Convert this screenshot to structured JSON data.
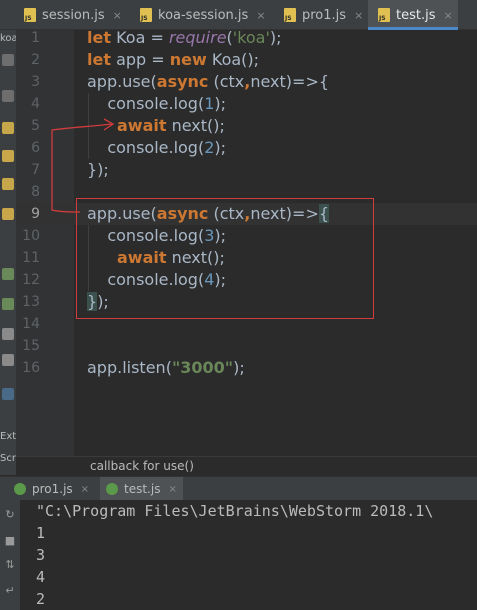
{
  "tabs": [
    {
      "label": "session.js",
      "active": false
    },
    {
      "label": "koa-session.js",
      "active": false
    },
    {
      "label": "pro1.js",
      "active": false
    },
    {
      "label": "test.js",
      "active": true
    }
  ],
  "close_glyph": "×",
  "strip_labels": [
    "koa",
    "Ext",
    "Scr"
  ],
  "line_numbers": [
    "1",
    "2",
    "3",
    "4",
    "5",
    "6",
    "7",
    "8",
    "9",
    "10",
    "11",
    "12",
    "13",
    "14",
    "15",
    "16"
  ],
  "code": {
    "l1": {
      "let": "let",
      "name": "Koa",
      "eq": " = ",
      "fn": "require",
      "open": "(",
      "str": "'koa'",
      "close": ");"
    },
    "l2": {
      "let": "let",
      "name": " app = ",
      "new": "new",
      "cls": " Koa",
      "end": "();"
    },
    "l3": {
      "obj": "app.use(",
      "async": "async",
      "sp": " (",
      "ctx": "ctx",
      "comma": ",",
      "next": "next",
      "arrow": ")=>{"
    },
    "l4": {
      "txt": "    console.log(",
      "num": "1",
      "end": ");"
    },
    "l5": {
      "await": "await",
      "rest": " next();"
    },
    "l6": {
      "txt": "    console.log(",
      "num": "2",
      "end": ");"
    },
    "l7": {
      "txt": "});"
    },
    "l9": {
      "obj": "app.use(",
      "async": "async",
      "sp": " (",
      "ctx": "ctx",
      "comma": ",",
      "next": "next",
      "arrow": ")=>",
      "brace": "{"
    },
    "l10": {
      "txt": "    console.log(",
      "num": "3",
      "end": ");"
    },
    "l11": {
      "await": "await",
      "rest": " next();"
    },
    "l12": {
      "txt": "    console.log(",
      "num": "4",
      "end": ");"
    },
    "l13": {
      "brace": "}",
      "end": ");"
    },
    "l16": {
      "obj": "app.listen(",
      "str": "\"3000\"",
      "end": ");"
    }
  },
  "breadcrumb": "callback for use()",
  "run_tabs": [
    {
      "label": "pro1.js",
      "active": false
    },
    {
      "label": "test.js",
      "active": true
    }
  ],
  "console": {
    "command": "\"C:\\Program Files\\JetBrains\\WebStorm 2018.1\\",
    "lines": [
      "1",
      "3",
      "4",
      "2"
    ]
  },
  "colors": {
    "annotation": "#d03c3c",
    "accent": "#4a88c7",
    "keyword": "#cc7832",
    "string": "#6a8759",
    "number": "#6897bb"
  }
}
